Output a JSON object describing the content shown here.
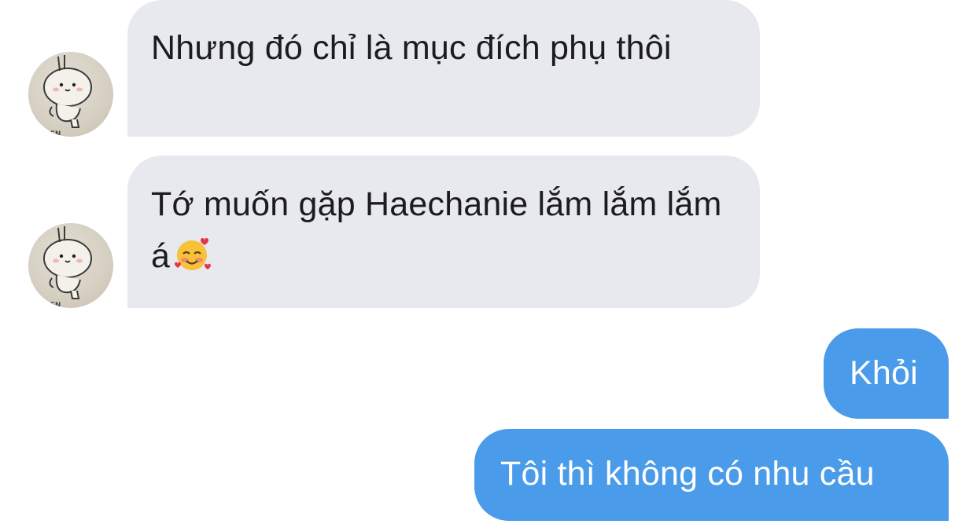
{
  "chat": {
    "messages": [
      {
        "direction": "incoming",
        "text": "Nhưng đó chỉ là mục đích phụ thôi",
        "avatar_icon": "bunny-avatar-icon"
      },
      {
        "direction": "incoming",
        "text": "Tớ muốn gặp Haechanie lắm lắm lắm á",
        "emoji": "smiling-face-with-hearts-emoji"
      },
      {
        "direction": "outgoing",
        "text": "Khỏi"
      },
      {
        "direction": "outgoing",
        "text": "Tôi thì không có nhu cầu"
      }
    ]
  },
  "colors": {
    "incoming_bubble": "#e7e9ee",
    "outgoing_bubble": "#4a9bea",
    "incoming_text": "#1c1c1e",
    "outgoing_text": "#ffffff"
  }
}
